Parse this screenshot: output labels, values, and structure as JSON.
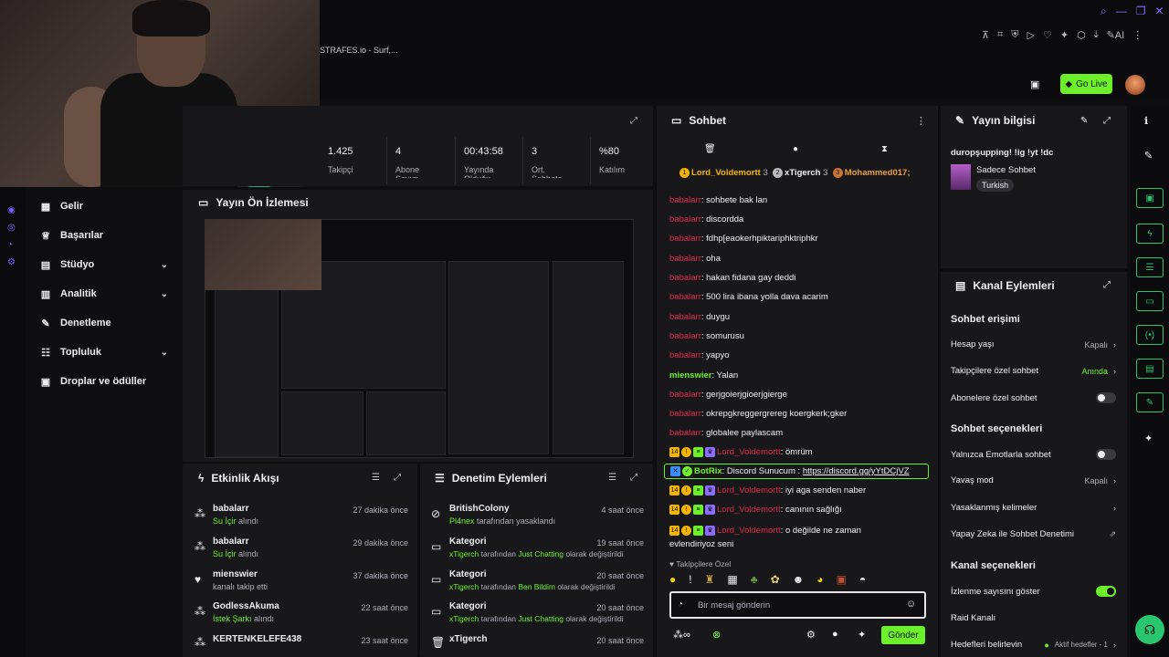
{
  "tab_title": "STRAFES.io - Surf,...",
  "go_live": "Go Live",
  "nav": [
    {
      "label": "Gelir",
      "chev": ""
    },
    {
      "label": "Başarılar",
      "chev": ""
    },
    {
      "label": "Stüdyo",
      "chev": "⌄"
    },
    {
      "label": "Analitik",
      "chev": "⌄"
    },
    {
      "label": "Denetleme",
      "chev": ""
    },
    {
      "label": "Topluluk",
      "chev": "⌄"
    },
    {
      "label": "Droplar ve ödüller",
      "chev": ""
    }
  ],
  "stats": [
    {
      "value": "1.425",
      "label": "Takipçi"
    },
    {
      "value": "4",
      "label": "Abone Sayısı"
    },
    {
      "value": "00:43:58",
      "label": "Yayında Olduğu"
    },
    {
      "value": "3",
      "label": "Ort. Sohbete"
    },
    {
      "value": "%80",
      "label": "Katılım"
    }
  ],
  "preview_title": "Yayın Ön İzlemesi",
  "activity": {
    "title": "Etkinlik Akışı",
    "items": [
      {
        "name": "babalarr",
        "action": "Su İçir",
        "suffix": "alındı",
        "time": "27 dakika önce"
      },
      {
        "name": "babalarr",
        "action": "Su İçir",
        "suffix": "alındı",
        "time": "29 dakika önce"
      },
      {
        "name": "mienswier",
        "action": "",
        "suffix": "kanalı takip etti",
        "time": "37 dakika önce"
      },
      {
        "name": "GodlessAkuma",
        "action": "İstek Şarkı",
        "suffix": "alındı",
        "time": "22 saat önce"
      },
      {
        "name": "KERTENKELEFE438",
        "action": "",
        "suffix": "",
        "time": "23 saat önce"
      }
    ]
  },
  "moderation": {
    "title": "Denetim Eylemleri",
    "items": [
      {
        "title": "BritishColony",
        "who": "Pl4nex",
        "text": "tarafından yasaklandı",
        "extra": "",
        "time": "4 saat önce"
      },
      {
        "title": "Kategori",
        "who": "xTigerch",
        "text": "tarafından",
        "extra": "Just Chatting",
        "tail": "olarak değiştirildi",
        "time": "19 saat önce"
      },
      {
        "title": "Kategori",
        "who": "xTigerch",
        "text": "tarafından",
        "extra": "Ben Bildim",
        "tail": "olarak değiştirildi",
        "time": "20 saat önce"
      },
      {
        "title": "Kategori",
        "who": "xTigerch",
        "text": "tarafından",
        "extra": "Just Chatting",
        "tail": "olarak değiştirildi",
        "time": "20 saat önce"
      },
      {
        "title": "xTigerch",
        "who": "",
        "text": "",
        "extra": "",
        "tail": "",
        "time": "20 saat önce"
      }
    ]
  },
  "chat": {
    "title": "Sohbet",
    "top": [
      {
        "name": "Lord_Voldemortt",
        "n": "3"
      },
      {
        "name": "xTigerch",
        "n": "3"
      },
      {
        "name": "Mohammed017;",
        "n": ""
      }
    ],
    "messages": [
      {
        "user": "babalarr",
        "text": "sohbete bak lan"
      },
      {
        "user": "babalarr",
        "text": "discordda"
      },
      {
        "user": "babalarr",
        "text": "fdhp[eaokerhpiktariphktriphkr"
      },
      {
        "user": "babalarr",
        "text": "oha"
      },
      {
        "user": "babalarr",
        "text": "hakan fidana gay deddi"
      },
      {
        "user": "babalarr",
        "text": "500 lira ibana yolla dava acarim"
      },
      {
        "user": "babalarr",
        "text": "duygu"
      },
      {
        "user": "babalarr",
        "text": "somurusu"
      },
      {
        "user": "babalarr",
        "text": "yapyo"
      },
      {
        "user": "mienswier",
        "text": "Yalan"
      },
      {
        "user": "babalarr",
        "text": "gerjgoierjgioerjgierge"
      },
      {
        "user": "babalarr",
        "text": "okrepgkreggergrereg koergkerk;gker"
      },
      {
        "user": "babalarr",
        "text": "globalee paylascam"
      }
    ],
    "vip_msgs": [
      {
        "user": "Lord_Voldemortt",
        "text": "ömrüm"
      },
      {
        "user": "Lord_Voldemortt",
        "text": "iyi aga senden naber"
      },
      {
        "user": "Lord_Voldemortt",
        "text": "canının sağlığı"
      },
      {
        "user": "Lord_Voldemortt",
        "text": "o değilde ne zaman evlendiriyoz seni"
      }
    ],
    "bot": {
      "user": "BotRix",
      "text": "Discord Sunucum :",
      "link": "https://discord.gg/yYtDCjVZ"
    },
    "followers_only": "Takipçilere Özel",
    "placeholder": "Bir mesaj gönderin",
    "send": "Gönder",
    "badge_num": "14"
  },
  "info": {
    "title": "Yayın bilgisi",
    "stream_title": "duropşupping! !ig !yt !dc",
    "category": "Sadece Sohbet",
    "tag": "Turkish"
  },
  "actions": {
    "title": "Kanal Eylemleri",
    "s1": "Sohbet erişimi",
    "hesap": "Hesap yaşı",
    "hesap_v": "Kapalı",
    "takip": "Takipçilere özel sohbet",
    "takip_v": "Anında",
    "abone": "Abonelere özel sohbet",
    "s2": "Sohbet seçenekleri",
    "emote": "Yalnızca Emotlarla sohbet",
    "yavas": "Yavaş mod",
    "yavas_v": "Kapalı",
    "yasak": "Yasaklanmış kelimeler",
    "ai": "Yapay Zeka ile Sohbet Denetimi",
    "s3": "Kanal seçenekleri",
    "izlenme": "İzlenme sayısını göster",
    "raid": "Raid Kanalı",
    "hedef": "Hedefleri belirlevin",
    "hedef_v": "Aktif hedefler - 1"
  },
  "colors": {
    "accent": "#6cf02a",
    "vip": "#e0284b"
  }
}
